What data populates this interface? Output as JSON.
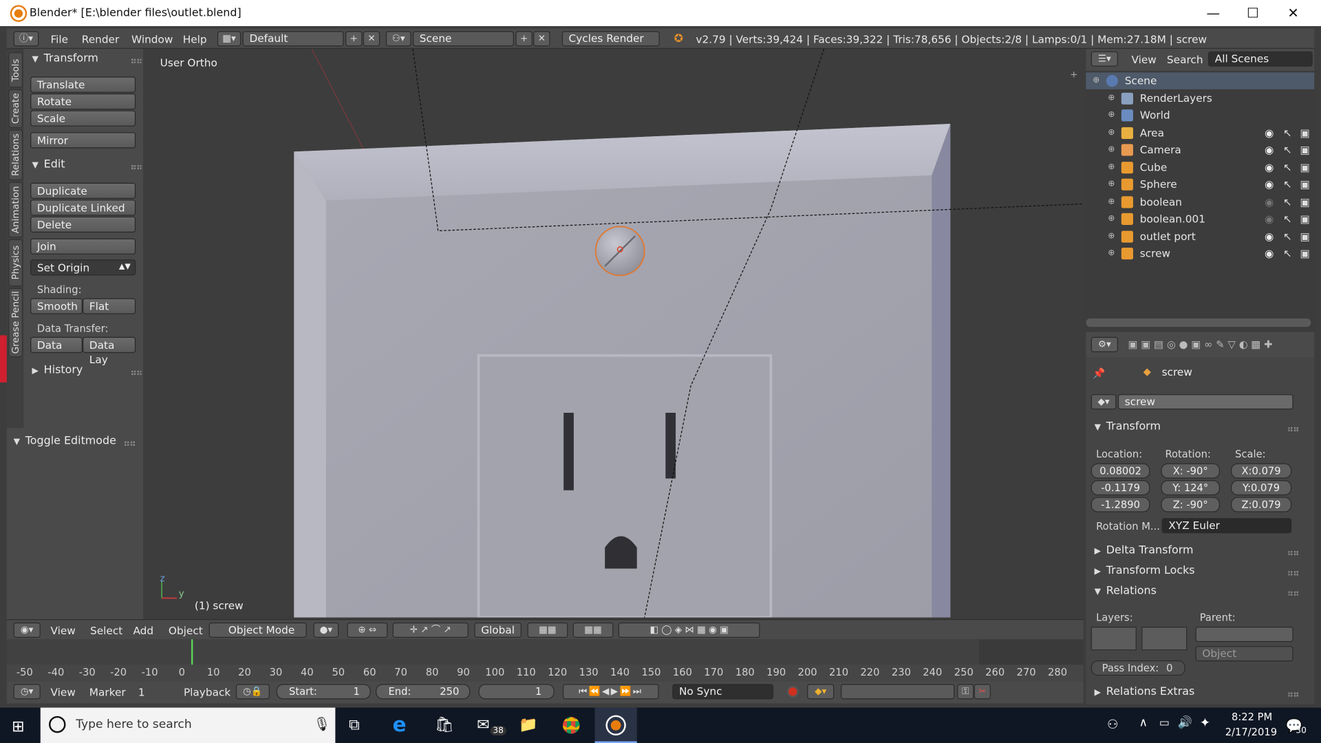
{
  "window": {
    "title": "Blender* [E:\\blender files\\outlet.blend]",
    "minimize": "—",
    "maximize": "☐",
    "close": "✕"
  },
  "menus": {
    "file": "File",
    "render": "Render",
    "window": "Window",
    "help": "Help"
  },
  "info": {
    "layout": "Default",
    "scene": "Scene",
    "engine": "Cycles Render",
    "stats": "v2.79 | Verts:39,424 | Faces:39,322 | Tris:78,656 | Objects:2/8 | Lamps:0/1 | Mem:27.18M | screw"
  },
  "tabs": [
    "Tools",
    "Create",
    "Relations",
    "Animation",
    "Physics",
    "Grease Pencil"
  ],
  "toolshelf": {
    "transform_header": "Transform",
    "translate": "Translate",
    "rotate": "Rotate",
    "scale": "Scale",
    "mirror": "Mirror",
    "edit_header": "Edit",
    "duplicate": "Duplicate",
    "duplicate_linked": "Duplicate Linked",
    "delete": "Delete",
    "join": "Join",
    "set_origin": "Set Origin",
    "shading_label": "Shading:",
    "smooth": "Smooth",
    "flat": "Flat",
    "data_transfer_label": "Data Transfer:",
    "data": "Data",
    "data_lay": "Data Lay",
    "history": "History",
    "toggle_editmode": "Toggle Editmode"
  },
  "viewport": {
    "view_name": "User Ortho",
    "object_label": "(1) screw",
    "axis_z": "z",
    "axis_y": "y"
  },
  "outliner": {
    "view": "View",
    "search": "Search",
    "filter": "All Scenes",
    "rows": [
      {
        "name": "Scene",
        "color": "#5a79b0"
      },
      {
        "name": "RenderLayers",
        "color": "#8aa0c0"
      },
      {
        "name": "World",
        "color": "#6a8cc0"
      },
      {
        "name": "Area",
        "color": "#e8b040"
      },
      {
        "name": "Camera",
        "color": "#e89a50"
      },
      {
        "name": "Cube",
        "color": "#e89a30"
      },
      {
        "name": "Sphere",
        "color": "#e89a30"
      },
      {
        "name": "boolean",
        "color": "#e89a30"
      },
      {
        "name": "boolean.001",
        "color": "#e89a30"
      },
      {
        "name": "outlet port",
        "color": "#e89a30"
      },
      {
        "name": "screw",
        "color": "#e89a30"
      }
    ]
  },
  "properties": {
    "context_object": "screw",
    "object_name": "screw",
    "transform_header": "Transform",
    "location_label": "Location:",
    "rotation_label": "Rotation:",
    "scale_label": "Scale:",
    "loc": [
      "0.08002",
      "-0.1179",
      "-1.2890"
    ],
    "rot": [
      "X:  -90°",
      "Y:  124°",
      "Z:  -90°"
    ],
    "scl": [
      "X:0.079",
      "Y:0.079",
      "Z:0.079"
    ],
    "rotation_mode_label": "Rotation M...",
    "rotation_mode": "XYZ Euler",
    "delta_transform": "Delta Transform",
    "transform_locks": "Transform Locks",
    "relations": "Relations",
    "layers_label": "Layers:",
    "parent_label": "Parent:",
    "parent_type": "Object",
    "pass_index": "Pass Index:",
    "pass_value": "0",
    "relations_extras": "Relations Extras"
  },
  "view3d_header": {
    "view": "View",
    "select": "Select",
    "add": "Add",
    "object": "Object",
    "mode": "Object Mode",
    "orientation": "Global"
  },
  "timeline": {
    "ticks": [
      "-50",
      "-40",
      "-30",
      "-20",
      "-10",
      "0",
      "10",
      "20",
      "30",
      "40",
      "50",
      "60",
      "70",
      "80",
      "90",
      "100",
      "110",
      "120",
      "130",
      "140",
      "150",
      "160",
      "170",
      "180",
      "190",
      "200",
      "210",
      "220",
      "230",
      "240",
      "250",
      "260",
      "270",
      "280"
    ],
    "current_frame": "1"
  },
  "timeline_header": {
    "view": "View",
    "marker": "Marker",
    "frame": "1",
    "playback": "Playback",
    "start_label": "Start:",
    "start": "1",
    "end_label": "End:",
    "end": "250",
    "sync": "No Sync"
  },
  "taskbar": {
    "search": "Type here to search",
    "mail_badge": "38",
    "time": "8:22 PM",
    "date": "2/17/2019",
    "notif": "30"
  }
}
